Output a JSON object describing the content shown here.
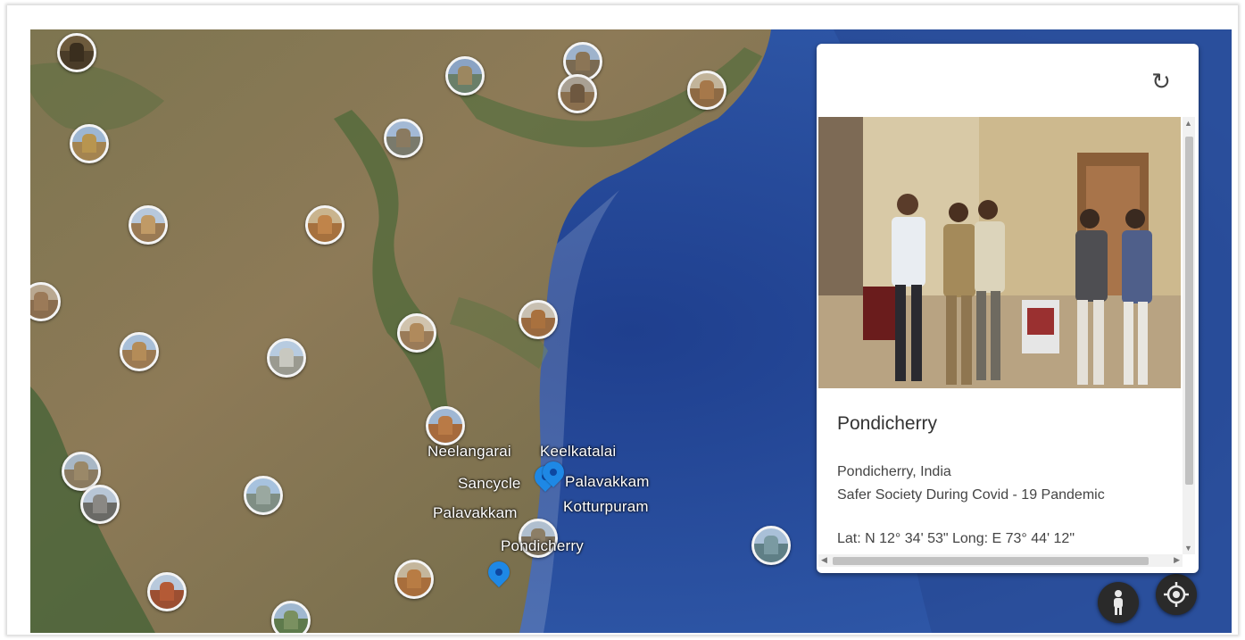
{
  "map": {
    "labels": [
      "Neelangarai",
      "Keelkatalai",
      "Sancycle",
      "Palavakkam",
      "Palavakkam",
      "Kotturpuram",
      "Pondicherry"
    ],
    "thumbnail_count": 26,
    "pin_count": 2
  },
  "info_card": {
    "refresh_icon": "refresh-icon",
    "title": "Pondicherry",
    "location": "Pondicherry, India",
    "description": "Safer Society During Covid - 19 Pandemic",
    "coordinates": "Lat: N 12° 34' 53\" Long: E 73° 44' 12\""
  },
  "controls": {
    "street_view_icon": "pegman-icon",
    "my_location_icon": "my-location-icon"
  },
  "colors": {
    "ocean": "#2a4d9c",
    "land": "#8a7a55",
    "pin": "#1e88e5",
    "label_text": "#ffffff"
  }
}
